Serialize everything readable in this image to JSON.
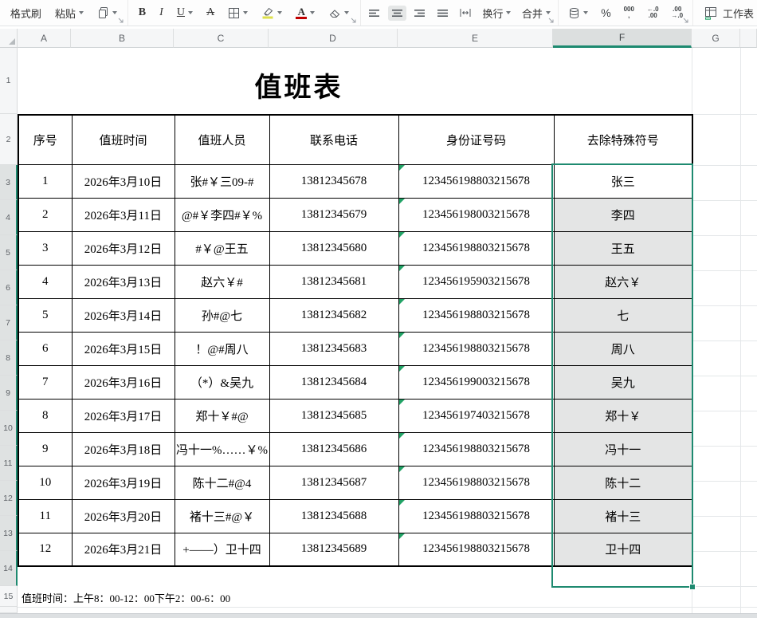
{
  "toolbar": {
    "format_painter": "格式刷",
    "paste": "粘贴",
    "bold": "B",
    "italic": "I",
    "underline": "U",
    "strikethrough": "A",
    "font_color_letter": "A",
    "wrap_text": "换行",
    "merge_cells": "合并",
    "number_format_percent": "%",
    "thousands_top": "000",
    "thousands_bottom": ",",
    "decrease_decimal_top": "←.0",
    "decrease_decimal_bottom": ".00",
    "increase_decimal_top": ".00",
    "increase_decimal_bottom": "→.0",
    "worksheet": "工作表"
  },
  "sheet": {
    "column_headers": [
      "A",
      "B",
      "C",
      "D",
      "E",
      "F",
      "G"
    ],
    "row_headers": [
      "1",
      "2",
      "3",
      "4",
      "5",
      "6",
      "7",
      "8",
      "9",
      "10",
      "11",
      "12",
      "13",
      "14",
      "15"
    ],
    "selected_column": "F",
    "selected_range": "F3:F14",
    "title": "值班表",
    "note": "值班时间：上午8：00-12：00下午2：00-6：00",
    "table": {
      "headers": [
        "序号",
        "值班时间",
        "值班人员",
        "联系电话",
        "身份证号码",
        "去除特殊符号"
      ],
      "rows": [
        [
          "1",
          "2026年3月10日",
          "张#￥三09-#",
          "13812345678",
          "123456198803215678",
          "张三"
        ],
        [
          "2",
          "2026年3月11日",
          "@#￥李四#￥%",
          "13812345679",
          "123456198003215678",
          "李四"
        ],
        [
          "3",
          "2026年3月12日",
          "#￥@王五",
          "13812345680",
          "123456198803215678",
          "王五"
        ],
        [
          "4",
          "2026年3月13日",
          "赵六￥#",
          "13812345681",
          "123456195903215678",
          "赵六￥"
        ],
        [
          "5",
          "2026年3月14日",
          "孙#@七",
          "13812345682",
          "123456198803215678",
          "七"
        ],
        [
          "6",
          "2026年3月15日",
          "！@#周八",
          "13812345683",
          "123456198803215678",
          "周八"
        ],
        [
          "7",
          "2026年3月16日",
          "（*）&吴九",
          "13812345684",
          "123456199003215678",
          "吴九"
        ],
        [
          "8",
          "2026年3月17日",
          "郑十￥#@",
          "13812345685",
          "123456197403215678",
          "郑十￥"
        ],
        [
          "9",
          "2026年3月18日",
          "冯十一%……￥%",
          "13812345686",
          "123456198803215678",
          "冯十一"
        ],
        [
          "10",
          "2026年3月19日",
          "陈十二#@4",
          "13812345687",
          "123456198803215678",
          "陈十二"
        ],
        [
          "11",
          "2026年3月20日",
          "褚十三#@￥",
          "13812345688",
          "123456198803215678",
          "褚十三"
        ],
        [
          "12",
          "2026年3月21日",
          "+——）卫十四",
          "13812345689",
          "123456198803215678",
          "卫十四"
        ]
      ]
    },
    "colors": {
      "selection_green": "#1e8a70",
      "triangle_green": "#21a366",
      "highlight_yellow": "#dde04a",
      "font_color_red": "#c00000"
    }
  }
}
